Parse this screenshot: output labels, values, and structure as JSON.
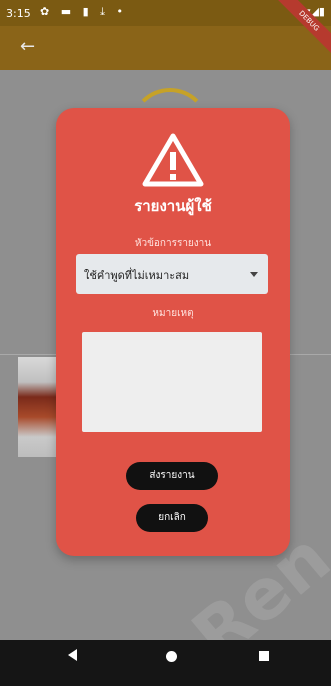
{
  "status_bar": {
    "time": "3:15",
    "left_icons": "✿ ▬ ▮ ⤓ •",
    "right_icons": "▾◢▮"
  },
  "appbar": {
    "back_glyph": "←",
    "debug_banner": "DEBUG"
  },
  "watermark": "Ren",
  "dialog": {
    "title": "รายงานผู้ใช้",
    "topic_label": "หัวข้อการรายงาน",
    "topic_value": "ใช้คำพูดที่ไม่เหมาะสม",
    "note_label": "หมายเหตุ",
    "note_value": "",
    "send_label": "ส่งรายงาน",
    "cancel_label": "ยกเลิก"
  },
  "colors": {
    "dialog": "#e05347",
    "accent": "#c6a227",
    "button": "#111111"
  },
  "icons": {
    "warning": "warning-icon",
    "back": "arrow-left-icon"
  }
}
